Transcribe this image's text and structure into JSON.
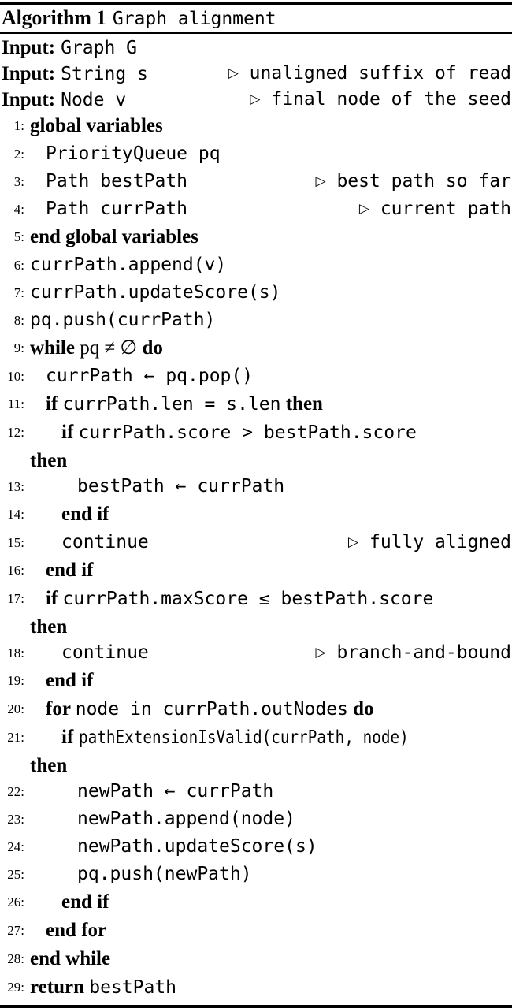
{
  "algorithm": {
    "label": "Algorithm 1",
    "name": "Graph alignment",
    "inputs": [
      {
        "keyword": "Input:",
        "code": "Graph G",
        "comment": null
      },
      {
        "keyword": "Input:",
        "code": "String s",
        "comment": "unaligned suffix of read"
      },
      {
        "keyword": "Input:",
        "code": "Node v",
        "comment": "final node of the seed"
      }
    ],
    "lines": [
      {
        "n": "1:",
        "indent": 0,
        "text": "global variables",
        "style": "kw",
        "comment": null,
        "cont": null
      },
      {
        "n": "2:",
        "indent": 1,
        "text": "PriorityQueue pq",
        "style": "code",
        "comment": null,
        "cont": null
      },
      {
        "n": "3:",
        "indent": 1,
        "text": "Path bestPath",
        "style": "code",
        "comment": "best path so far",
        "cont": null
      },
      {
        "n": "4:",
        "indent": 1,
        "text": "Path currPath",
        "style": "code",
        "comment": "current path",
        "cont": null
      },
      {
        "n": "5:",
        "indent": 0,
        "text": "end global variables",
        "style": "kw",
        "comment": null,
        "cont": null
      },
      {
        "n": "6:",
        "indent": 0,
        "text": "currPath.append(v)",
        "style": "code",
        "comment": null,
        "cont": null
      },
      {
        "n": "7:",
        "indent": 0,
        "text": "currPath.updateScore(s)",
        "style": "code",
        "comment": null,
        "cont": null
      },
      {
        "n": "8:",
        "indent": 0,
        "text": "pq.push(currPath)",
        "style": "code",
        "comment": null,
        "cont": null
      },
      {
        "n": "9:",
        "indent": 0,
        "kw_pre": "while",
        "text": "pq ≠ ∅",
        "style": "math",
        "kw_post": "do",
        "comment": null,
        "cont": null
      },
      {
        "n": "10:",
        "indent": 1,
        "text": "currPath ← pq.pop()",
        "style": "code",
        "comment": null,
        "cont": null
      },
      {
        "n": "11:",
        "indent": 1,
        "kw_pre": "if",
        "text": "currPath.len = s.len",
        "style": "code",
        "kw_post": "then",
        "comment": null,
        "cont": null
      },
      {
        "n": "12:",
        "indent": 2,
        "kw_pre": "if",
        "text": "currPath.score > bestPath.score",
        "style": "code",
        "kw_post": null,
        "comment": null,
        "cont": "then"
      },
      {
        "n": "13:",
        "indent": 3,
        "text": "bestPath ← currPath",
        "style": "code",
        "comment": null,
        "cont": null
      },
      {
        "n": "14:",
        "indent": 2,
        "text": "end if",
        "style": "kw",
        "comment": null,
        "cont": null
      },
      {
        "n": "15:",
        "indent": 2,
        "text": "continue",
        "style": "code",
        "comment": "fully aligned",
        "cont": null
      },
      {
        "n": "16:",
        "indent": 1,
        "text": "end if",
        "style": "kw",
        "comment": null,
        "cont": null
      },
      {
        "n": "17:",
        "indent": 1,
        "kw_pre": "if",
        "text": "currPath.maxScore ≤ bestPath.score",
        "style": "code",
        "kw_post": null,
        "comment": null,
        "cont": "then"
      },
      {
        "n": "18:",
        "indent": 2,
        "text": "continue",
        "style": "code",
        "comment": "branch-and-bound",
        "cont": null
      },
      {
        "n": "19:",
        "indent": 1,
        "text": "end if",
        "style": "kw",
        "comment": null,
        "cont": null
      },
      {
        "n": "20:",
        "indent": 1,
        "kw_pre": "for",
        "text": "node in currPath.outNodes",
        "style": "code",
        "kw_post": "do",
        "comment": null,
        "cont": null
      },
      {
        "n": "21:",
        "indent": 2,
        "kw_pre": "if",
        "text": "pathExtensionIsValid(currPath, node)",
        "style": "narrow",
        "kw_post": null,
        "comment": null,
        "cont": "then"
      },
      {
        "n": "22:",
        "indent": 3,
        "text": "newPath ← currPath",
        "style": "code",
        "comment": null,
        "cont": null
      },
      {
        "n": "23:",
        "indent": 3,
        "text": "newPath.append(node)",
        "style": "code",
        "comment": null,
        "cont": null
      },
      {
        "n": "24:",
        "indent": 3,
        "text": "newPath.updateScore(s)",
        "style": "code",
        "comment": null,
        "cont": null
      },
      {
        "n": "25:",
        "indent": 3,
        "text": "pq.push(newPath)",
        "style": "code",
        "comment": null,
        "cont": null
      },
      {
        "n": "26:",
        "indent": 2,
        "text": "end if",
        "style": "kw",
        "comment": null,
        "cont": null
      },
      {
        "n": "27:",
        "indent": 1,
        "text": "end for",
        "style": "kw",
        "comment": null,
        "cont": null
      },
      {
        "n": "28:",
        "indent": 0,
        "text": "end while",
        "style": "kw",
        "comment": null,
        "cont": null
      },
      {
        "n": "29:",
        "indent": 0,
        "kw_pre": "return",
        "text": "bestPath",
        "style": "code",
        "kw_post": null,
        "comment": null,
        "cont": null
      }
    ],
    "comment_marker": "▷"
  }
}
